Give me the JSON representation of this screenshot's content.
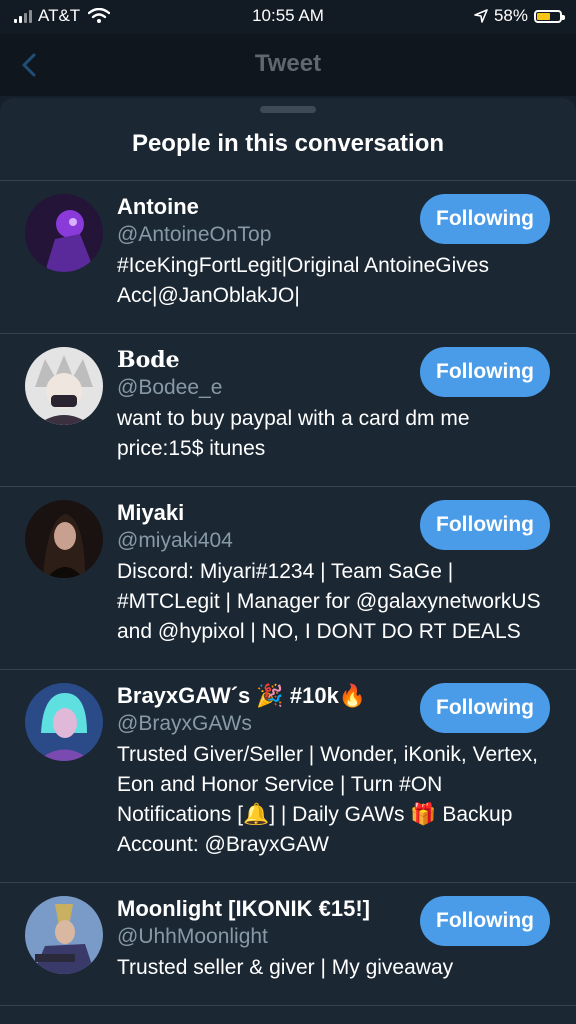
{
  "status_bar": {
    "carrier": "AT&T",
    "time": "10:55 AM",
    "battery": "58%",
    "battery_level": 0.58
  },
  "nav": {
    "title": "Tweet"
  },
  "sheet": {
    "title": "People in this conversation",
    "people": [
      {
        "name": "Antoine",
        "handle": "@AntoineOnTop",
        "bio": "#IceKingFortLegit|Original AntoineGives Acc|@JanOblakJO|",
        "button": "Following",
        "avatar_colors": [
          "#2a1a4a",
          "#8a3ad8"
        ]
      },
      {
        "name": "Bode",
        "handle": "@Bodee_e",
        "bio": "want to buy paypal with a card dm me price:15$ itunes",
        "button": "Following",
        "avatar_colors": [
          "#d8d8d8",
          "#3a3040"
        ]
      },
      {
        "name": "Miyaki",
        "handle": "@miyaki404",
        "bio": "Discord: Miyari#1234 | Team SaGe | #MTCLegit | Manager for @galaxynetworkUS and @hypixol | NO, I DONT DO RT DEALS",
        "button": "Following",
        "avatar_colors": [
          "#1a1210",
          "#c8a090"
        ]
      },
      {
        "name": "BrayxGAW´s 🎉 #10k🔥",
        "handle": "@BrayxGAWs",
        "bio": "Trusted Giver/Seller | Wonder, iKonik, Vertex, Eon and Honor Service | Turn #ON Notifications [🔔] | Daily GAWs 🎁 Backup Account: @BrayxGAW",
        "button": "Following",
        "avatar_colors": [
          "#2a6aa8",
          "#5ee0e0"
        ]
      },
      {
        "name": "Moonlight [IKONIK €15!]",
        "handle": "@UhhMoonlight",
        "bio": "Trusted seller & giver | My giveaway",
        "button": "Following",
        "avatar_colors": [
          "#6a8ab8",
          "#c8b060"
        ]
      }
    ]
  },
  "colors": {
    "background": "#15202b",
    "sheet": "#1b2733",
    "accent": "#4a9be8",
    "secondary_text": "#8899a6"
  }
}
